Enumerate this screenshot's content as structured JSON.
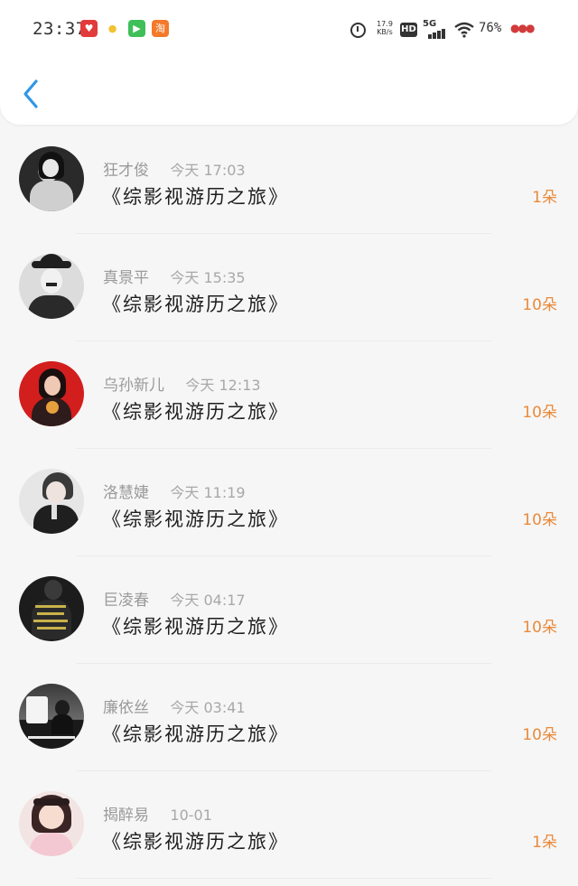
{
  "status_bar": {
    "time": "23:37",
    "app_icons": [
      {
        "name": "app-icon-red",
        "glyph": "♥",
        "color": "#e23b3b"
      },
      {
        "name": "app-icon-yellow",
        "glyph": "●",
        "color": "#f2c230"
      },
      {
        "name": "app-icon-video",
        "glyph": "▶",
        "color": "#3fbf5a"
      },
      {
        "name": "app-icon-taobao",
        "glyph": "淘",
        "color": "#f4792a"
      }
    ],
    "net_speed_value": "17.9",
    "net_speed_unit": "KB/s",
    "hd_label": "HD",
    "network_label": "5G",
    "battery": "76%"
  },
  "header": {
    "back_icon": "chevron-left-icon",
    "accent": "#2f97e8"
  },
  "records": [
    {
      "name": "狂才俊",
      "time": "今天 17:03",
      "title": "《综影视游历之旅》",
      "amount": "1朵",
      "avatar_colors": [
        "#1a1a1a",
        "#c9c9c9"
      ]
    },
    {
      "name": "真景平",
      "time": "今天 15:35",
      "title": "《综影视游历之旅》",
      "amount": "10朵",
      "avatar_colors": [
        "#d6d6d6",
        "#222222"
      ]
    },
    {
      "name": "乌孙新儿",
      "time": "今天 12:13",
      "title": "《综影视游历之旅》",
      "amount": "10朵",
      "avatar_colors": [
        "#d01f1f",
        "#2a1a18"
      ]
    },
    {
      "name": "洛慧婕",
      "time": "今天 11:19",
      "title": "《综影视游历之旅》",
      "amount": "10朵",
      "avatar_colors": [
        "#e4e4e4",
        "#2b2b2b"
      ]
    },
    {
      "name": "巨凌春",
      "time": "今天 04:17",
      "title": "《综影视游历之旅》",
      "amount": "10朵",
      "avatar_colors": [
        "#1c1c1c",
        "#c9b24a"
      ]
    },
    {
      "name": "廉依丝",
      "time": "今天 03:41",
      "title": "《综影视游历之旅》",
      "amount": "10朵",
      "avatar_colors": [
        "#3a3a3a",
        "#f0f0f0"
      ]
    },
    {
      "name": "揭醉易",
      "time": "10-01",
      "title": "《综影视游历之旅》",
      "amount": "1朵",
      "avatar_colors": [
        "#f3d6d6",
        "#2a1c1c"
      ]
    }
  ],
  "colors": {
    "amount": "#e98a3a",
    "background": "#f6f6f6"
  }
}
